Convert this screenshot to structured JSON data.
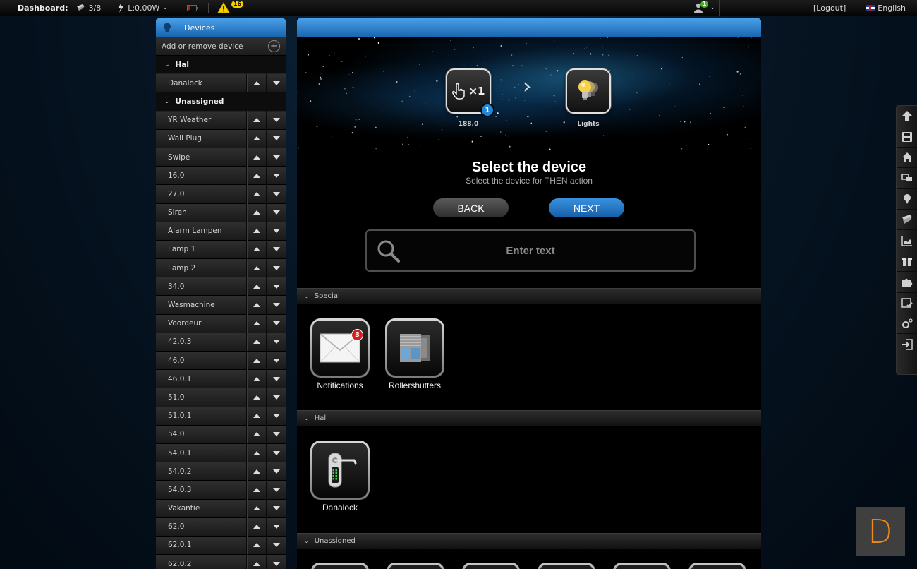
{
  "topbar": {
    "dashboard_label": "Dashboard:",
    "devices_count": "3/8",
    "power": "L:0.00W",
    "warnings_count": "16",
    "users_count": "1",
    "logout": "[Logout]",
    "language": "English"
  },
  "sidebar": {
    "title": "Devices",
    "add_remove": "Add or remove device",
    "groups": [
      {
        "name": "Hal",
        "devices": [
          "Danalock"
        ]
      },
      {
        "name": "Unassigned",
        "devices": [
          "YR Weather",
          "Wall Plug",
          "Swipe",
          "16.0",
          "27.0",
          "Siren",
          "Alarm Lampen",
          "Lamp 1",
          "Lamp 2",
          "34.0",
          "Wasmachine",
          "Voordeur",
          "42.0.3",
          "46.0",
          "46.0.1",
          "51.0",
          "51.0.1",
          "54.0",
          "54.0.1",
          "54.0.2",
          "54.0.3",
          "Vakantie",
          "62.0",
          "62.0.1",
          "62.0.2"
        ]
      }
    ]
  },
  "wizard": {
    "step1_label": "188.0",
    "step1_badge": "1",
    "step1_multiplier": "×1",
    "step2_label": "Lights",
    "title": "Select the device",
    "subtitle": "Select the device for THEN action",
    "back": "BACK",
    "next": "NEXT",
    "search_placeholder": "Enter text"
  },
  "sections": [
    {
      "name": "Special",
      "tiles": [
        {
          "label": "Notifications",
          "icon": "envelope-icon",
          "badge": "3"
        },
        {
          "label": "Rollershutters",
          "icon": "rollershutter-icon"
        }
      ]
    },
    {
      "name": "Hal",
      "tiles": [
        {
          "label": "Danalock",
          "icon": "door-lock-icon"
        }
      ]
    },
    {
      "name": "Unassigned",
      "tiles": []
    }
  ],
  "right_toolbar": [
    "arrow-up-icon",
    "save-icon",
    "home-icon",
    "devices-icon",
    "map-pin-icon",
    "scene-icon",
    "chart-icon",
    "gift-icon",
    "plugin-icon",
    "calendar-check-icon",
    "settings-icon",
    "logout-icon"
  ],
  "corner_logo": "D",
  "colors": {
    "accent_blue": "#1f86d8",
    "badge_red": "#d21e1e",
    "warning_yellow": "#f5d000",
    "logo_orange": "#f08a1c"
  }
}
